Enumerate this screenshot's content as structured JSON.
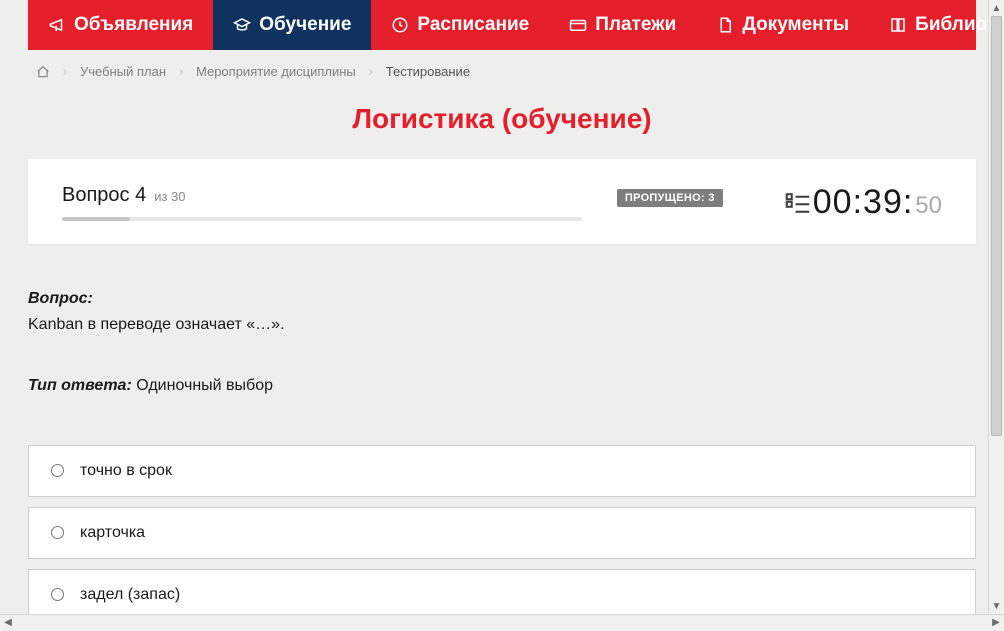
{
  "nav": {
    "items": [
      {
        "label": "Объявления",
        "icon": "megaphone-icon",
        "active": false
      },
      {
        "label": "Обучение",
        "icon": "graduation-icon",
        "active": true
      },
      {
        "label": "Расписание",
        "icon": "clock-icon",
        "active": false
      },
      {
        "label": "Платежи",
        "icon": "card-icon",
        "active": false
      },
      {
        "label": "Документы",
        "icon": "doc-icon",
        "active": false
      },
      {
        "label": "Библиотека",
        "icon": "book-icon",
        "active": false,
        "chevron": true
      }
    ]
  },
  "breadcrumb": {
    "items": [
      {
        "label": "Учебный план"
      },
      {
        "label": "Мероприятие дисциплины"
      }
    ],
    "current": "Тестирование"
  },
  "title": "Логистика (обучение)",
  "qheader": {
    "question_label": "Вопрос 4",
    "of_label": "из 30",
    "skipped_label": "ПРОПУЩЕНО: 3",
    "timer_main": "00:39:",
    "timer_sec": "50",
    "progress_pct": 13
  },
  "question": {
    "q_label": "Вопрос:",
    "text": "Kanban в переводе означает «…».",
    "answer_type_label": "Тип ответа:",
    "answer_type": "Одиночный выбор"
  },
  "options": [
    {
      "label": "точно в срок"
    },
    {
      "label": "карточка"
    },
    {
      "label": "задел (запас)"
    }
  ]
}
